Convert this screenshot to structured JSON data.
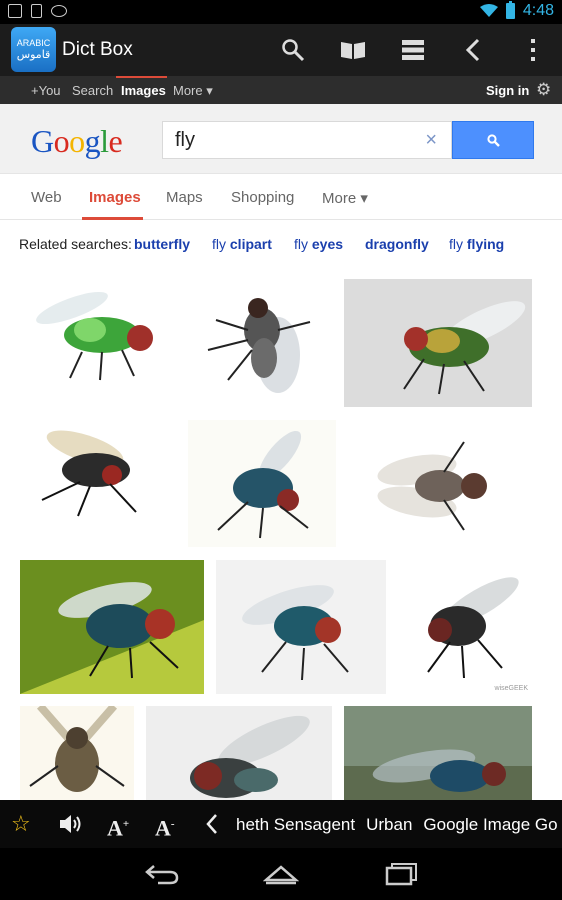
{
  "status_bar": {
    "time": "4:48",
    "icons": [
      "image-notification-icon",
      "sd-card-icon",
      "android-icon",
      "wifi-icon",
      "battery-icon"
    ]
  },
  "app_bar": {
    "logo_top": "ARABIC",
    "logo_bottom": "قاموس",
    "title": "Dict Box",
    "actions": [
      "search-icon",
      "book-icon",
      "list-icon",
      "back-icon",
      "overflow-menu-icon"
    ]
  },
  "google_nav": {
    "items": [
      "+You",
      "Search",
      "Images",
      "More ▾"
    ],
    "active": "Images",
    "sign_in": "Sign in"
  },
  "google_header": {
    "logo": [
      "G",
      "o",
      "o",
      "g",
      "l",
      "e"
    ],
    "query": "fly",
    "clear": "×",
    "accent": "#4d90fe"
  },
  "tabs": {
    "items": [
      "Web",
      "Images",
      "Maps",
      "Shopping",
      "More ▾"
    ],
    "active": "Images"
  },
  "related": {
    "label": "Related searches:",
    "links": [
      {
        "pre": "",
        "bold": "butterfly"
      },
      {
        "pre": "fly ",
        "bold": "clipart"
      },
      {
        "pre": "fly ",
        "bold": "eyes"
      },
      {
        "pre": "",
        "bold": "dragonfly"
      },
      {
        "pre": "fly ",
        "bold": "flying"
      }
    ]
  },
  "images": [
    {
      "alt": "green fly on white"
    },
    {
      "alt": "grey fly top view"
    },
    {
      "alt": "green bottle fly on grey surface"
    },
    {
      "alt": "black fly with red eyes"
    },
    {
      "alt": "blue fly on white"
    },
    {
      "alt": "grey fly top view wings spread"
    },
    {
      "alt": "blue bottle fly on green leaf"
    },
    {
      "alt": "blue fly on white surface"
    },
    {
      "alt": "black fly side view",
      "watermark": "wiseGEEK"
    },
    {
      "alt": "fly illustration"
    },
    {
      "alt": "fly close-up"
    },
    {
      "alt": "blue fly on blurred background"
    }
  ],
  "dict_toolbar": {
    "tools": [
      "star-icon",
      "speaker-icon",
      "font-larger-icon",
      "font-smaller-icon",
      "chevron-left-icon"
    ],
    "sources": [
      "heth Sensagent",
      "Urban",
      "Google Image Go"
    ]
  },
  "nav_bar": [
    "back-nav-icon",
    "home-nav-icon",
    "recents-nav-icon"
  ]
}
